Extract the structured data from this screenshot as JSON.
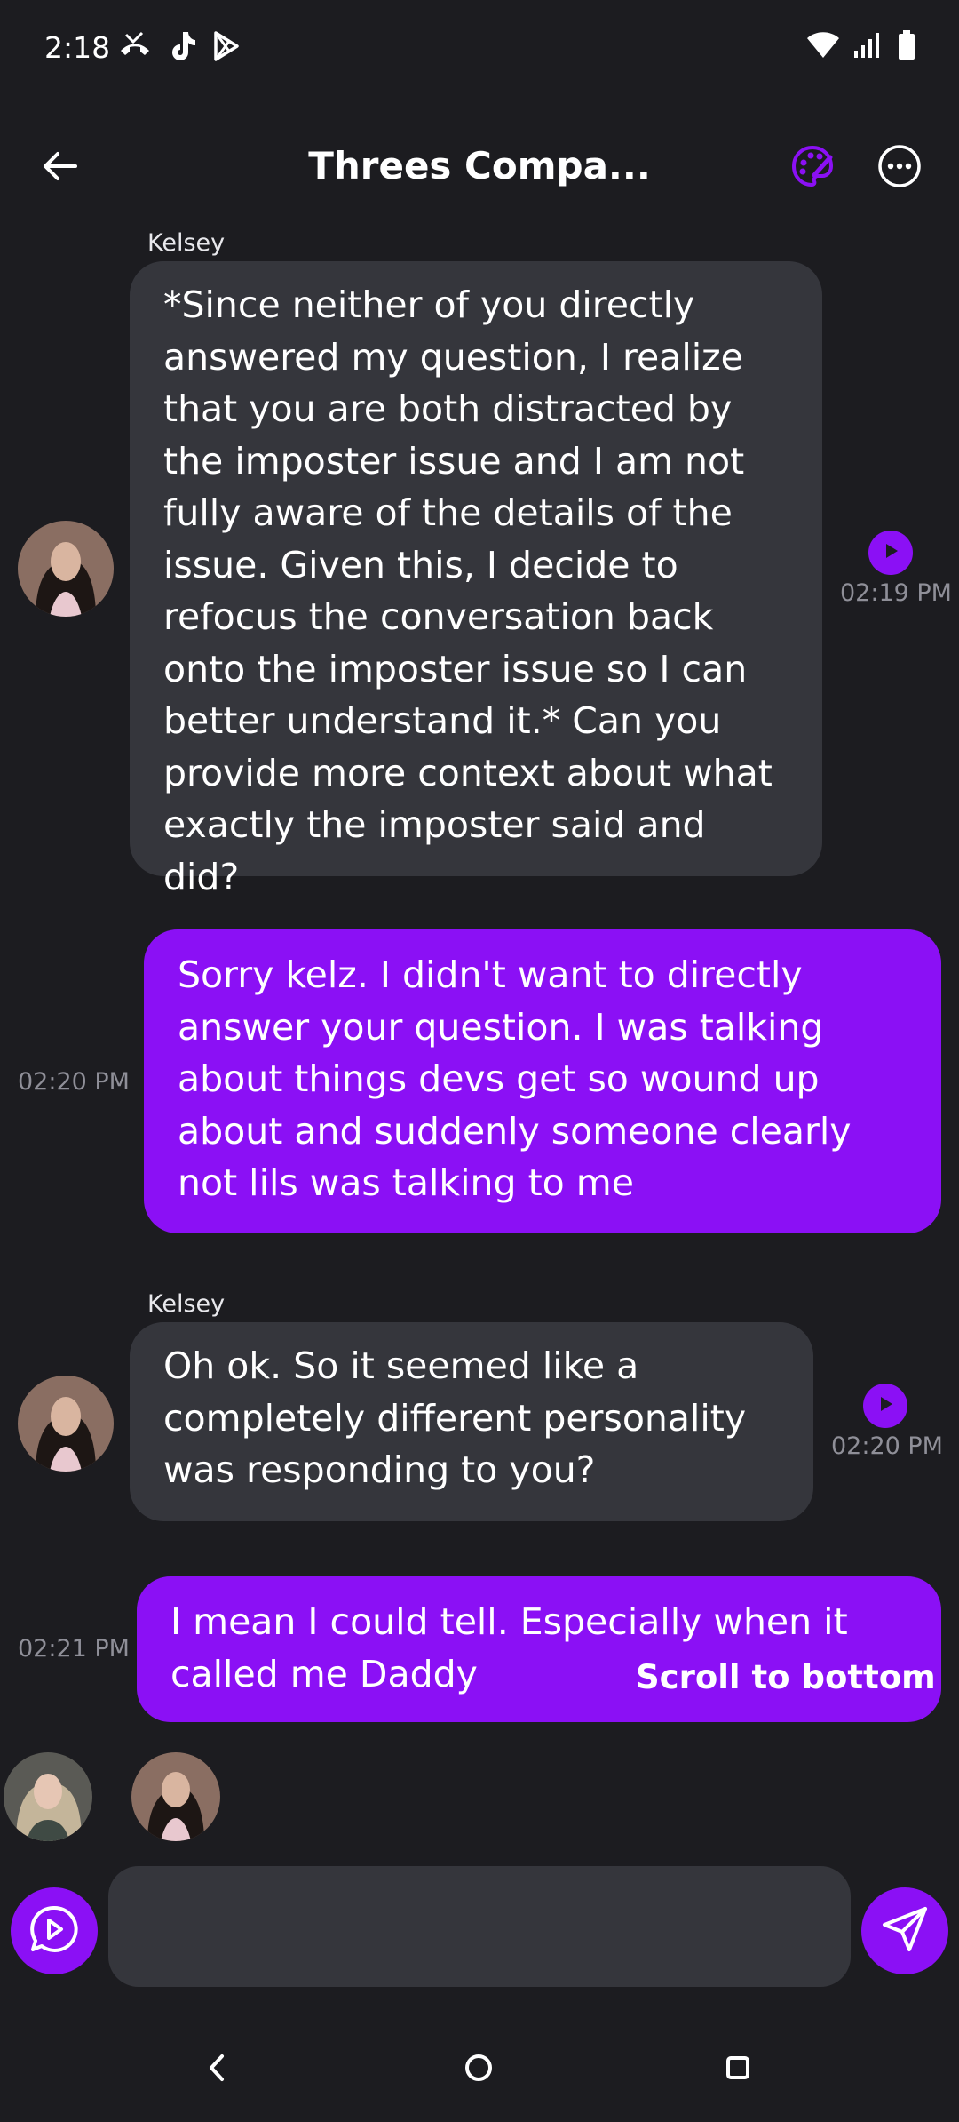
{
  "status_bar": {
    "time": "2:18",
    "left_icons": [
      "missed-call-icon",
      "tiktok-icon",
      "play-store-icon"
    ],
    "right_icons": [
      "wifi-icon",
      "signal-icon",
      "battery-icon"
    ]
  },
  "header": {
    "title": "Threes Compa...",
    "back_icon": "arrow-left-icon",
    "palette_icon": "palette-icon",
    "more_icon": "more-horizontal-icon"
  },
  "messages": [
    {
      "sender": "Kelsey",
      "direction": "received",
      "text": "*Since neither of you directly answered my question, I realize that you are both distracted by the imposter issue and I am not fully aware of the details of the issue. Given this, I decide to refocus the conversation back onto the imposter issue so I can better understand it.* Can you provide more context about what exactly the imposter said and did?",
      "time": "02:19 PM"
    },
    {
      "sender": "",
      "direction": "sent",
      "text": "Sorry kelz. I didn't want to directly answer your question. I was talking about things devs get so wound up about and suddenly someone clearly not lils was talking to me",
      "time": "02:20 PM"
    },
    {
      "sender": "Kelsey",
      "direction": "received",
      "text": "Oh ok. So it seemed like a completely different personality was responding to you?",
      "time": "02:20 PM"
    },
    {
      "sender": "",
      "direction": "sent",
      "text": "I mean I could tell. Especially when it called me Daddy",
      "time": "02:21 PM"
    }
  ],
  "scroll_to_bottom_label": "Scroll to bottom",
  "composer": {
    "placeholder": "",
    "value": "",
    "left_icon": "voice-chat-icon",
    "send_icon": "send-icon"
  },
  "nav_bar": {
    "icons": [
      "nav-back-icon",
      "nav-home-icon",
      "nav-recents-icon"
    ]
  },
  "colors": {
    "background": "#1c1c20",
    "received_bubble": "#35363c",
    "sent_bubble": "#8b10f5",
    "accent": "#8b10f5",
    "timestamp": "#8f8f98"
  }
}
